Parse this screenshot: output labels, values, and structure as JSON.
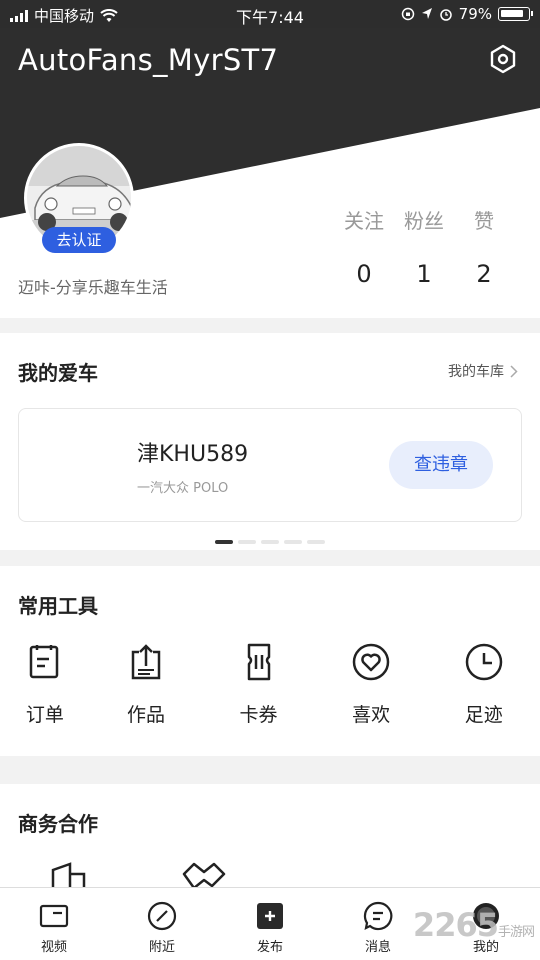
{
  "status_bar": {
    "carrier": "中国移动",
    "time": "下午7:44",
    "battery": "79%"
  },
  "profile": {
    "username": "AutoFans_MyrST7",
    "verify_label": "去认证",
    "slogan": "迈咔-分享乐趣车生活",
    "stats": [
      {
        "label": "关注",
        "value": "0"
      },
      {
        "label": "粉丝",
        "value": "1"
      },
      {
        "label": "赞",
        "value": "2"
      }
    ]
  },
  "my_car": {
    "title": "我的爱车",
    "garage_link": "我的车库",
    "plate": "津KHU589",
    "model": "一汽大众  POLO",
    "violation_button": "查违章",
    "carousel_active_index": 0,
    "carousel_count": 5
  },
  "tools": {
    "title": "常用工具",
    "items": [
      {
        "label": "订单",
        "icon": "order-icon"
      },
      {
        "label": "作品",
        "icon": "works-icon"
      },
      {
        "label": "卡券",
        "icon": "coupon-icon"
      },
      {
        "label": "喜欢",
        "icon": "heart-icon"
      },
      {
        "label": "足迹",
        "icon": "clock-icon"
      }
    ]
  },
  "business": {
    "title": "商务合作"
  },
  "bottom_nav": [
    {
      "label": "视频",
      "icon": "video-icon"
    },
    {
      "label": "附近",
      "icon": "compass-icon"
    },
    {
      "label": "发布",
      "icon": "publish-icon"
    },
    {
      "label": "消息",
      "icon": "message-icon"
    },
    {
      "label": "我的",
      "icon": "profile-icon"
    }
  ],
  "watermark": {
    "main": "2265",
    "sub": "手游网"
  }
}
